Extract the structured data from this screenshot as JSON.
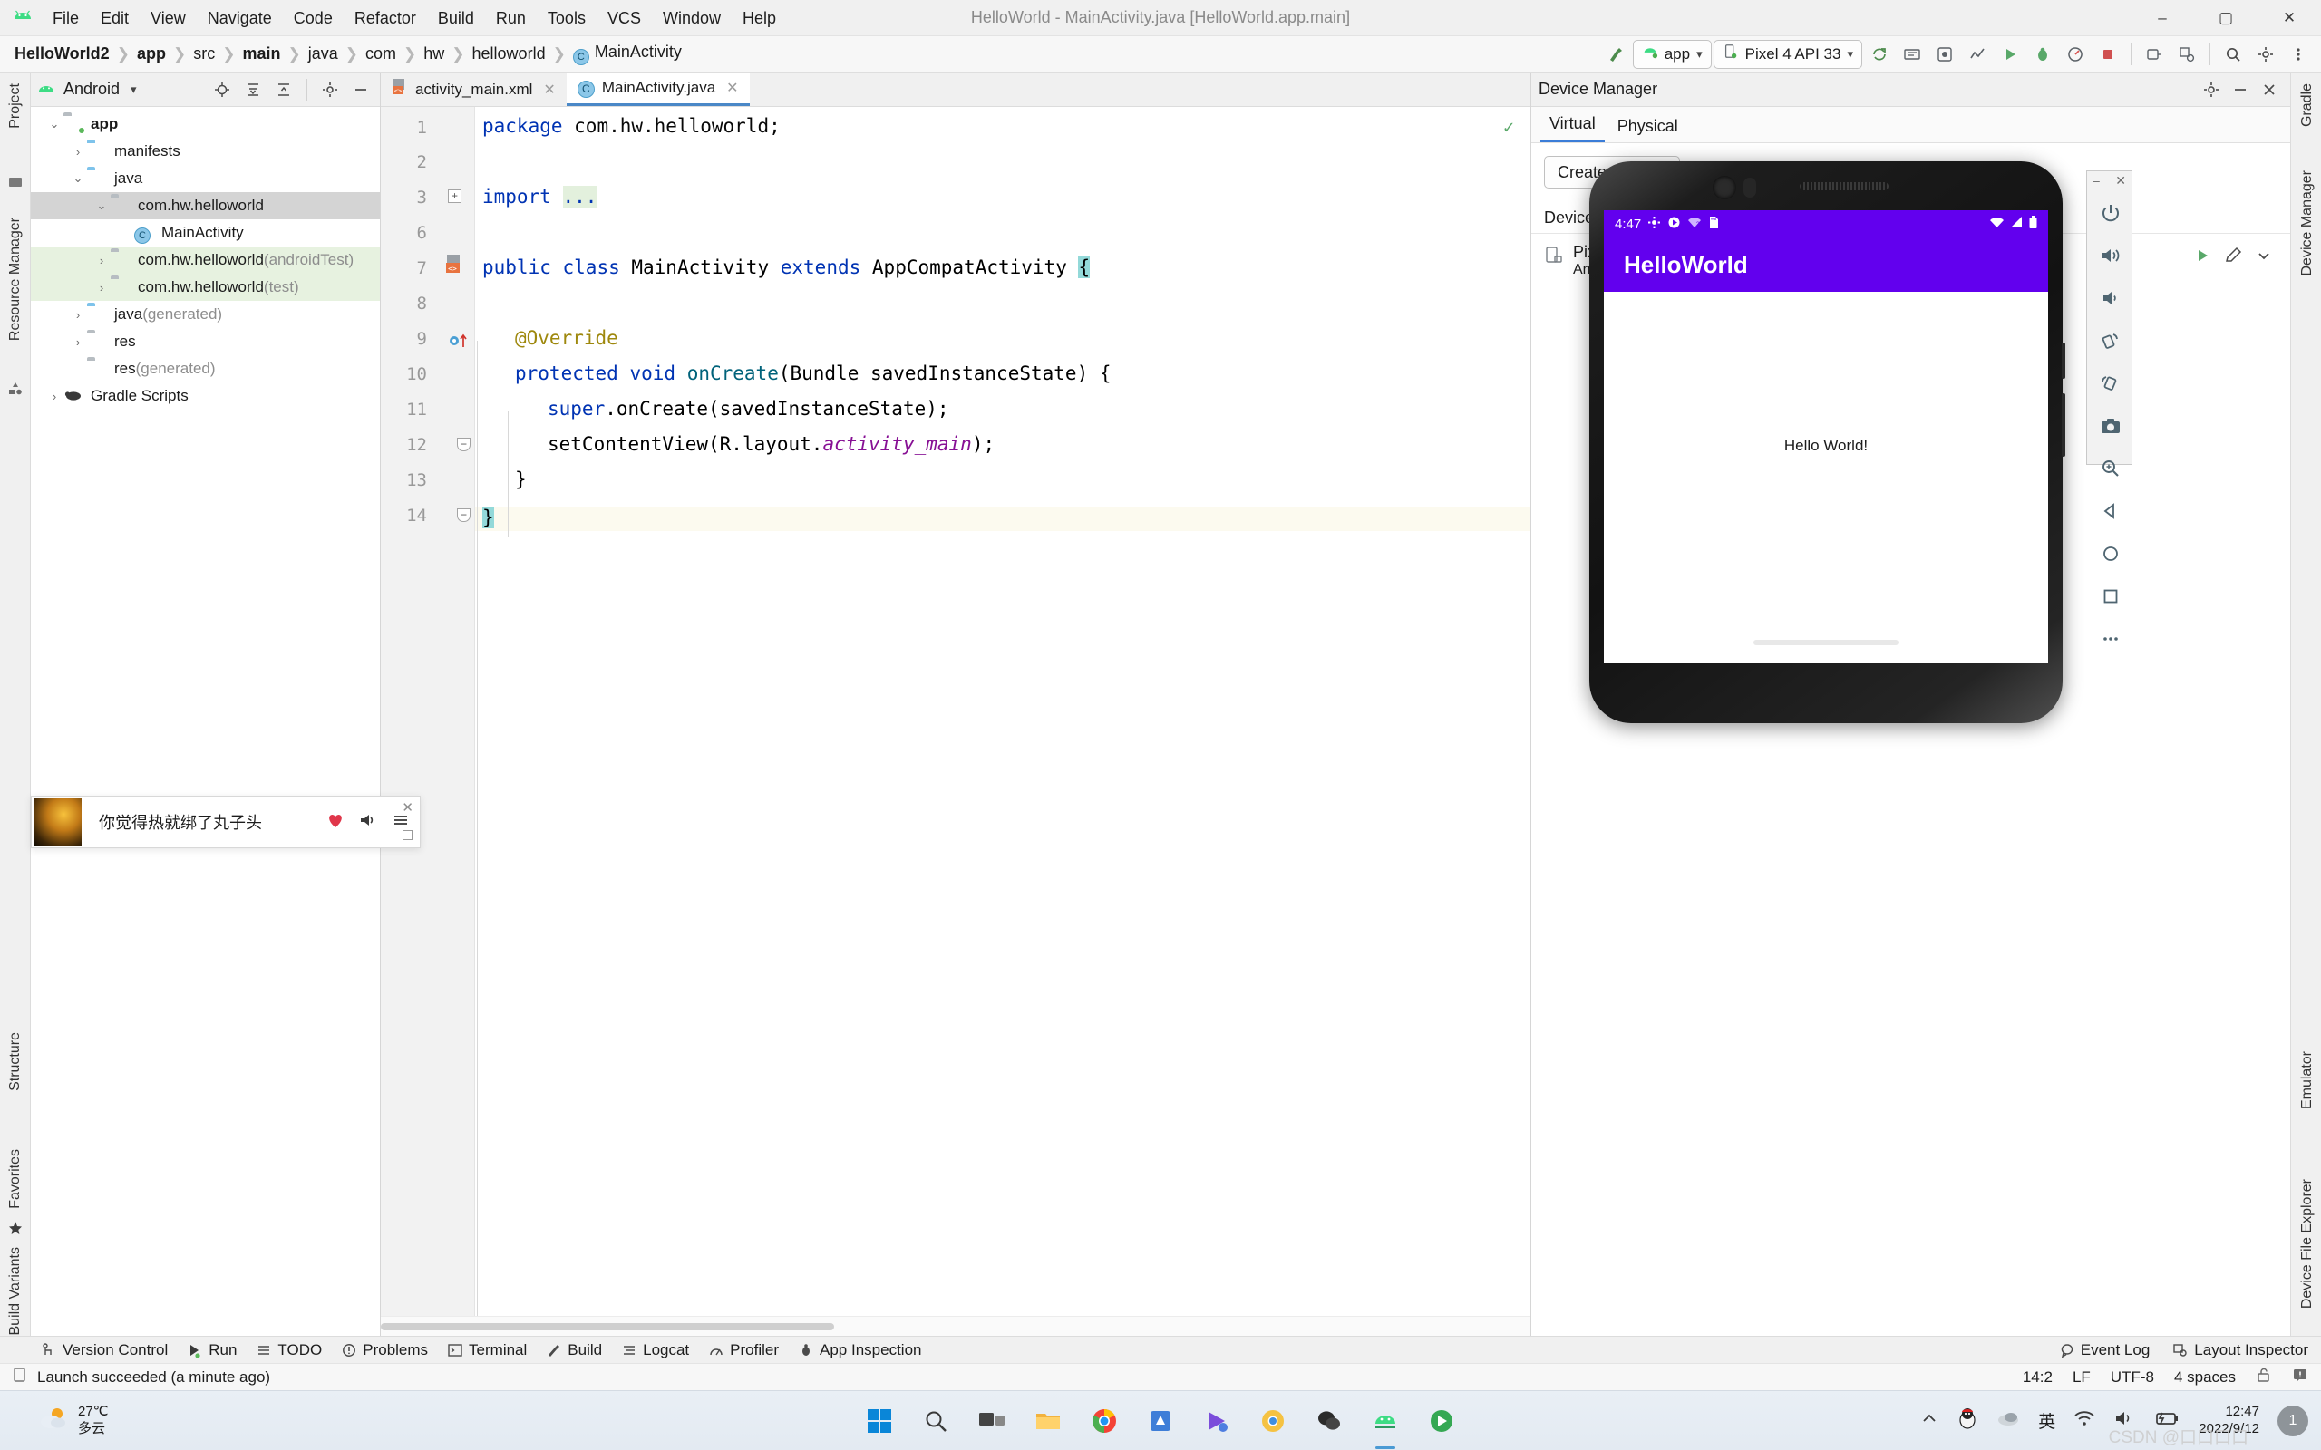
{
  "window": {
    "title": "HelloWorld - MainActivity.java [HelloWorld.app.main]",
    "minimize": "–",
    "maximize": "▢",
    "close": "✕"
  },
  "menubar": {
    "items": [
      "File",
      "Edit",
      "View",
      "Navigate",
      "Code",
      "Refactor",
      "Build",
      "Run",
      "Tools",
      "VCS",
      "Window",
      "Help"
    ]
  },
  "breadcrumb": {
    "separator": "❯",
    "items": [
      {
        "label": "HelloWorld2",
        "bold": true
      },
      {
        "label": "app",
        "bold": true
      },
      {
        "label": "src",
        "bold": false
      },
      {
        "label": "main",
        "bold": true
      },
      {
        "label": "java",
        "bold": false
      },
      {
        "label": "com",
        "bold": false
      },
      {
        "label": "hw",
        "bold": false
      },
      {
        "label": "helloworld",
        "bold": false
      },
      {
        "label": "MainActivity",
        "bold": false,
        "icon": "C"
      }
    ]
  },
  "toolbar": {
    "build_label": "make-project-icon",
    "run_config": "app",
    "device": "Pixel 4 API 33",
    "chevron": "▾",
    "icons": [
      "sync-project-icon",
      "avd-manager-icon",
      "sdk-manager-icon",
      "run-icon",
      "debug-icon",
      "profile-icon",
      "stop-icon",
      "attach-debugger-icon",
      "layout-inspector-icon",
      "search-icon",
      "settings-icon",
      "more-icon"
    ]
  },
  "left_strips": {
    "top": [
      "Project"
    ],
    "bottom": [
      "Structure",
      "Favorites",
      "Build Variants"
    ]
  },
  "right_strips": {
    "top": [
      "Gradle",
      "Device Manager"
    ],
    "bottom": [
      "Emulator",
      "Device File Explorer"
    ]
  },
  "project_panel": {
    "title": "Android",
    "chevron": "▾",
    "header_icons": [
      "locate-icon",
      "expand-all-icon",
      "collapse-all-icon",
      "settings-icon",
      "hide-icon"
    ],
    "tree": [
      {
        "label": "app",
        "suffix": "",
        "depth": 0,
        "twist": "v",
        "icon": "module",
        "bold": true,
        "state": "normal"
      },
      {
        "label": "manifests",
        "suffix": "",
        "depth": 1,
        "twist": ">",
        "icon": "folder-blue",
        "bold": false,
        "state": "normal"
      },
      {
        "label": "java",
        "suffix": "",
        "depth": 1,
        "twist": "v",
        "icon": "folder-blue",
        "bold": false,
        "state": "normal"
      },
      {
        "label": "com.hw.helloworld",
        "suffix": "",
        "depth": 2,
        "twist": "v",
        "icon": "package",
        "bold": false,
        "state": "selected"
      },
      {
        "label": "MainActivity",
        "suffix": "",
        "depth": 3,
        "twist": "",
        "icon": "class",
        "bold": false,
        "state": "normal"
      },
      {
        "label": "com.hw.helloworld",
        "suffix": " (androidTest)",
        "depth": 2,
        "twist": ">",
        "icon": "package",
        "bold": false,
        "state": "green"
      },
      {
        "label": "com.hw.helloworld",
        "suffix": " (test)",
        "depth": 2,
        "twist": ">",
        "icon": "package",
        "bold": false,
        "state": "green"
      },
      {
        "label": "java",
        "suffix": " (generated)",
        "depth": 1,
        "twist": ">",
        "icon": "folder-gen",
        "bold": false,
        "state": "normal"
      },
      {
        "label": "res",
        "suffix": "",
        "depth": 1,
        "twist": ">",
        "icon": "folder-res",
        "bold": false,
        "state": "normal"
      },
      {
        "label": "res",
        "suffix": " (generated)",
        "depth": 1,
        "twist": "",
        "icon": "folder-res",
        "bold": false,
        "state": "normal"
      },
      {
        "label": "Gradle Scripts",
        "suffix": "",
        "depth": 0,
        "twist": ">",
        "icon": "gradle",
        "bold": false,
        "state": "normal"
      }
    ]
  },
  "editor": {
    "tabs": [
      {
        "label": "activity_main.xml",
        "icon": "xml-layout-icon",
        "active": false,
        "close": "✕"
      },
      {
        "label": "MainActivity.java",
        "icon": "java-class-icon",
        "active": true,
        "close": "✕"
      }
    ],
    "inspection_ok": "✓",
    "line_numbers": [
      "1",
      "2",
      "3",
      "6",
      "7",
      "8",
      "9",
      "10",
      "11",
      "12",
      "13",
      "14"
    ],
    "lines": [
      {
        "num": "1",
        "text": "package com.hw.helloworld;"
      },
      {
        "num": "2",
        "text": ""
      },
      {
        "num": "3",
        "text": "import ..."
      },
      {
        "num": "6",
        "text": ""
      },
      {
        "num": "7",
        "text": "public class MainActivity extends AppCompatActivity {"
      },
      {
        "num": "8",
        "text": ""
      },
      {
        "num": "9",
        "text": "    @Override"
      },
      {
        "num": "10",
        "text": "    protected void onCreate(Bundle savedInstanceState) {"
      },
      {
        "num": "11",
        "text": "        super.onCreate(savedInstanceState);"
      },
      {
        "num": "12",
        "text": "        setContentView(R.layout.activity_main);"
      },
      {
        "num": "13",
        "text": "    }"
      },
      {
        "num": "14",
        "text": "}"
      }
    ],
    "tokens": {
      "kw_package": "package",
      "pkg_name": " com.hw.helloworld;",
      "kw_import": "import",
      "import_dots": "...",
      "kw_public": "public",
      "kw_class": "class",
      "cls_name": " MainActivity ",
      "kw_extends": "extends",
      "super_cls": " AppCompatActivity ",
      "brace_open": "{",
      "annotation": "@Override",
      "kw_protected": "protected",
      "kw_void": "void",
      "m_oncreate": "onCreate",
      "params": "(Bundle savedInstanceState) {",
      "kw_super": "super",
      "super_call": ".onCreate(savedInstanceState);",
      "m_setcontent": "setContentView",
      "setcontent_args_a": "(R.layout.",
      "setcontent_field": "activity_main",
      "setcontent_args_b": ");",
      "brace_close_inner": "}",
      "brace_close_outer": "}"
    }
  },
  "device_manager": {
    "title": "Device Manager",
    "header_icons": [
      "settings-icon",
      "minimize-icon",
      "close-icon"
    ],
    "tabs": [
      {
        "label": "Virtual",
        "active": true
      },
      {
        "label": "Physical",
        "active": false
      }
    ],
    "create_button": "Create device",
    "column_header": "Device",
    "device_name": "Pixel 4 API 33",
    "device_sub": "Android 13.0 x86_64",
    "row_icons": [
      "play-icon",
      "edit-icon",
      "dropdown-icon"
    ]
  },
  "emulator": {
    "window_controls": {
      "minimize": "–",
      "close": "✕"
    },
    "tools": [
      {
        "name": "power-icon"
      },
      {
        "name": "volume-up-icon"
      },
      {
        "name": "volume-down-icon"
      },
      {
        "name": "rotate-left-icon"
      },
      {
        "name": "rotate-right-icon"
      },
      {
        "name": "screenshot-icon"
      },
      {
        "name": "zoom-icon"
      },
      {
        "name": "back-icon"
      },
      {
        "name": "home-icon"
      },
      {
        "name": "overview-icon"
      },
      {
        "name": "more-icon"
      }
    ],
    "screen": {
      "status_time": "4:47",
      "status_icons": [
        "settings-icon",
        "play-store-icon",
        "wifi-alert-icon",
        "sd-card-icon"
      ],
      "status_right_icons": [
        "wifi-icon",
        "signal-icon",
        "battery-icon"
      ],
      "app_title": "HelloWorld",
      "body_text": "Hello World!",
      "theme_color": "#6200ee"
    }
  },
  "notification": {
    "text": "你觉得热就绑了丸子头",
    "icons": [
      "heart-icon",
      "speaker-icon",
      "playlist-icon"
    ],
    "close": "✕"
  },
  "bottom_toolwindows": [
    {
      "label": "Version Control",
      "icon": "branch-icon"
    },
    {
      "label": "Run",
      "icon": "run-icon"
    },
    {
      "label": "TODO",
      "icon": "todo-icon"
    },
    {
      "label": "Problems",
      "icon": "problems-icon"
    },
    {
      "label": "Terminal",
      "icon": "terminal-icon"
    },
    {
      "label": "Build",
      "icon": "build-icon"
    },
    {
      "label": "Logcat",
      "icon": "logcat-icon"
    },
    {
      "label": "Profiler",
      "icon": "profiler-icon"
    },
    {
      "label": "App Inspection",
      "icon": "app-inspection-icon"
    }
  ],
  "bottom_right_toolwindows": [
    {
      "label": "Event Log",
      "icon": "event-log-icon"
    },
    {
      "label": "Layout Inspector",
      "icon": "layout-inspector-icon"
    }
  ],
  "status_bar": {
    "message": "Launch succeeded (a minute ago)",
    "message_icon": "device-icon",
    "caret": "14:2",
    "line_ending": "LF",
    "encoding": "UTF-8",
    "indent": "4 spaces",
    "lock_icon": "unlocked-icon",
    "notify_icon": "notification-icon"
  },
  "taskbar": {
    "weather_temp": "27℃",
    "weather_desc": "多云",
    "apps": [
      {
        "name": "start-icon"
      },
      {
        "name": "search-icon"
      },
      {
        "name": "task-view-icon"
      },
      {
        "name": "file-explorer-icon"
      },
      {
        "name": "chrome-icon"
      },
      {
        "name": "store-icon"
      },
      {
        "name": "video-editor-icon"
      },
      {
        "name": "chrome-canary-icon"
      },
      {
        "name": "wechat-icon"
      },
      {
        "name": "android-studio-icon"
      },
      {
        "name": "emulator-icon"
      }
    ],
    "tray": [
      "chevron-up-icon",
      "qq-icon",
      "cloud-icon",
      "ime-icon",
      "wifi-icon",
      "volume-icon",
      "battery-icon"
    ],
    "ime_label": "英",
    "clock_time": "12:47",
    "clock_date": "2022/9/12",
    "badge": "1",
    "watermark": "CSDN @口口口口"
  }
}
